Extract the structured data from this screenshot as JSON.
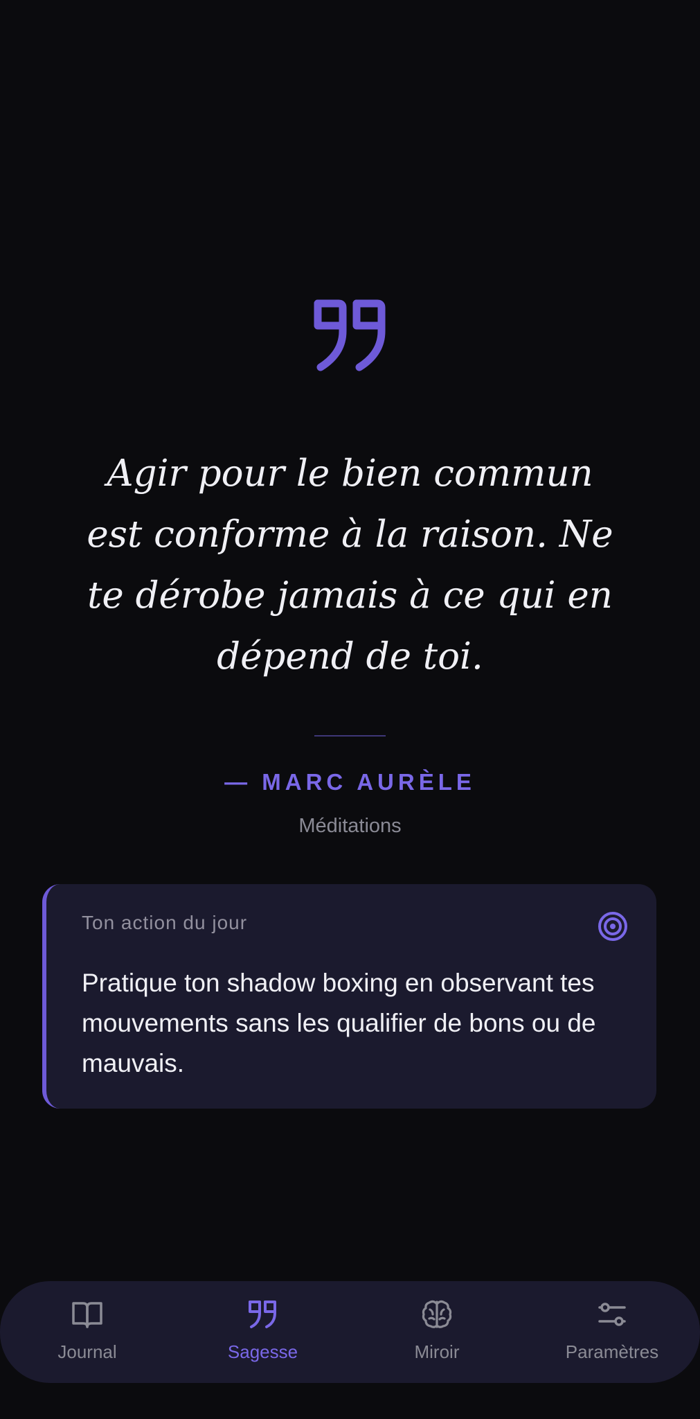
{
  "quote": {
    "icon": "quote-mark-icon",
    "text": "Agir pour le bien commun est conforme à la raison. Ne te dérobe jamais à ce qui en dépend de toi.",
    "author": "— MARC AURÈLE",
    "source": "Méditations"
  },
  "action_card": {
    "label": "Ton action du jour",
    "icon": "target-icon",
    "text": "Pratique ton shadow boxing en observant tes mouvements sans les qualifier de bons ou de mauvais."
  },
  "nav": {
    "items": [
      {
        "label": "Journal",
        "icon": "book-icon",
        "active": false
      },
      {
        "label": "Sagesse",
        "icon": "quote-mark-icon",
        "active": true
      },
      {
        "label": "Miroir",
        "icon": "brain-icon",
        "active": false
      },
      {
        "label": "Paramètres",
        "icon": "sliders-icon",
        "active": false
      }
    ]
  },
  "colors": {
    "background": "#0b0b0e",
    "surface": "#1b1a2e",
    "accent": "#7a68e8",
    "muted_text": "#8b8b95",
    "text": "#f0f0f5"
  }
}
